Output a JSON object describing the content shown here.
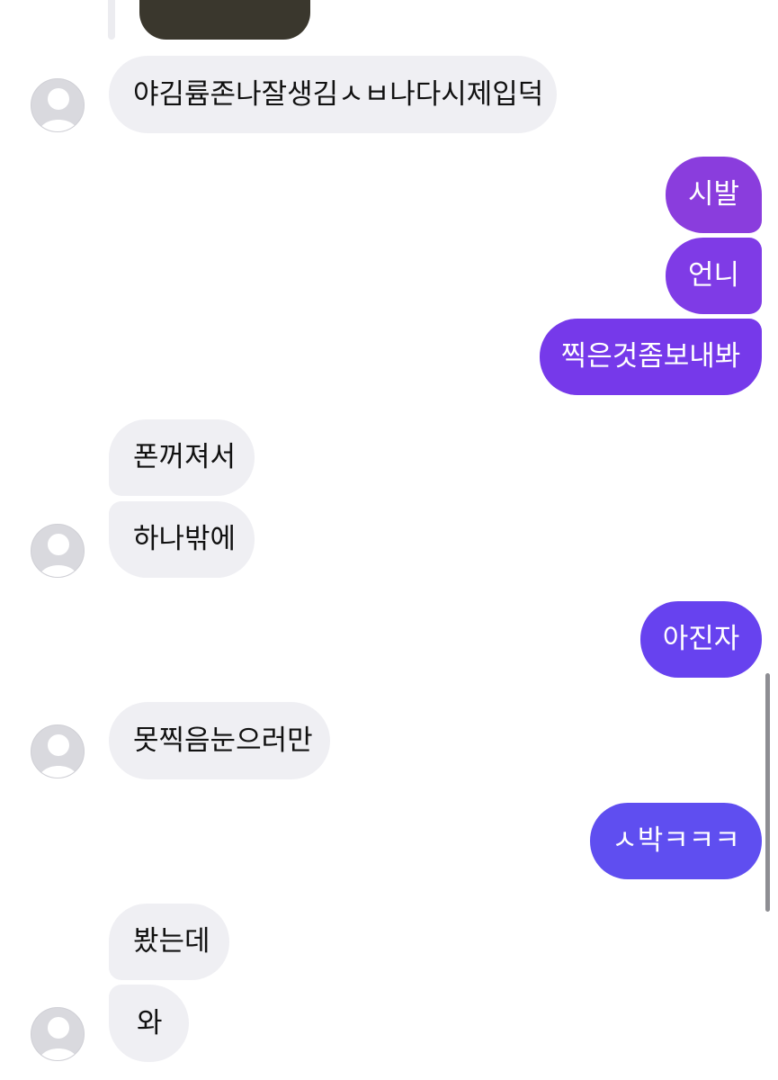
{
  "conversation": {
    "attachment_preview": "media-thumbnail",
    "messages": [
      {
        "direction": "incoming",
        "text": "야김륨존나잘생김ㅅㅂ나다시제입덕"
      },
      {
        "direction": "outgoing",
        "text": "시발"
      },
      {
        "direction": "outgoing",
        "text": "언니"
      },
      {
        "direction": "outgoing",
        "text": "찍은것좀보내봐"
      },
      {
        "direction": "incoming",
        "text": "폰꺼져서"
      },
      {
        "direction": "incoming",
        "text": "하나밖에"
      },
      {
        "direction": "outgoing",
        "text": "아진자"
      },
      {
        "direction": "incoming",
        "text": "못찍음눈으러만"
      },
      {
        "direction": "outgoing",
        "text": "ㅅ박ㅋㅋㅋ"
      },
      {
        "direction": "incoming",
        "text": "봤는데"
      },
      {
        "direction": "incoming",
        "text": "와"
      }
    ]
  },
  "colors": {
    "incoming_bubble": "#efeff3",
    "incoming_text": "#111111",
    "outgoing_gradient": [
      "#8a3ddd",
      "#7a3ae8",
      "#6a42ef",
      "#5f4ef0"
    ],
    "outgoing_text": "#ffffff",
    "avatar_bg": "#d9d9de",
    "avatar_figure": "#ffffff"
  },
  "icons": {
    "avatar": "default-profile-silhouette-icon"
  }
}
